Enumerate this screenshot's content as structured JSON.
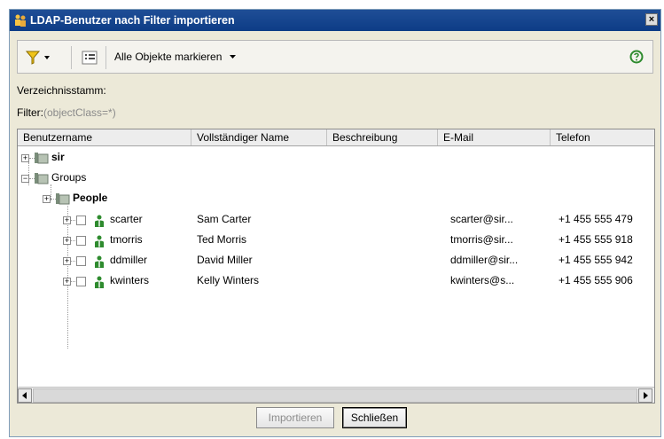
{
  "window": {
    "title": "LDAP-Benutzer nach Filter importieren",
    "close_glyph": "×"
  },
  "toolbar": {
    "mark_all_label": "Alle Objekte markieren"
  },
  "labels": {
    "directory_root": "Verzeichnisstamm:",
    "filter_prefix": "Filter:",
    "filter_value": "(objectClass=*)"
  },
  "columns": [
    "Benutzername",
    "Vollständiger Name",
    "Beschreibung",
    "E-Mail",
    "Telefon"
  ],
  "tree": {
    "sir": "sir",
    "groups": "Groups",
    "people": "People",
    "users": [
      {
        "username": "scarter",
        "fullname": "Sam Carter",
        "description": "",
        "email": "scarter@sir...",
        "phone": "+1 455 555 479"
      },
      {
        "username": "tmorris",
        "fullname": "Ted Morris",
        "description": "",
        "email": "tmorris@sir...",
        "phone": "+1 455 555 918"
      },
      {
        "username": "ddmiller",
        "fullname": "David Miller",
        "description": "",
        "email": "ddmiller@sir...",
        "phone": "+1 455 555 942"
      },
      {
        "username": "kwinters",
        "fullname": "Kelly Winters",
        "description": "",
        "email": "kwinters@s...",
        "phone": "+1 455 555 906"
      }
    ]
  },
  "buttons": {
    "import": "Importieren",
    "close": "Schließen"
  },
  "colors": {
    "titlebar": "#0d3c86",
    "help": "#2e8b2e",
    "filter_funnel": "#f0c419",
    "user_icon": "#2e8b2e"
  }
}
